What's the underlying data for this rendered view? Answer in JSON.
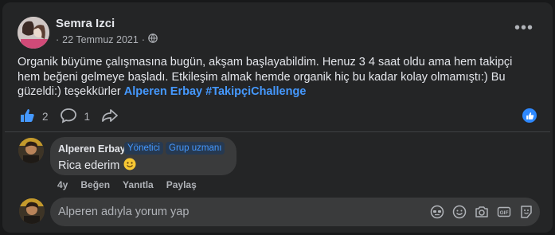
{
  "post": {
    "author": "Semra Izci",
    "date": "22 Temmuz 2021",
    "separator": "·",
    "text_main": "Organik büyüme çalışmasına bugün, akşam başlayabildim. Henuz 3 4 saat oldu ama hem takipçi hem beğeni gelmeye başladı. Etkileşim almak hemde organik hiç bu kadar kolay olmamıştı:) Bu güzeldi:) teşekkürler",
    "mention": "Alperen Erbay",
    "hashtag": "#TakipçiChallenge",
    "likes": "2",
    "comments": "1"
  },
  "comment": {
    "author": "Alperen Erbay",
    "badge_admin": "Yönetici",
    "badge_expert": "Grup uzmanı",
    "text": "Rica ederim",
    "time": "4y",
    "like_label": "Beğen",
    "reply_label": "Yanıtla",
    "share_label": "Paylaş"
  },
  "composer": {
    "placeholder": "Alperen adıyla yorum yap"
  },
  "colors": {
    "accent": "#4599ff",
    "card": "#242526",
    "bubble": "#3a3b3c"
  }
}
